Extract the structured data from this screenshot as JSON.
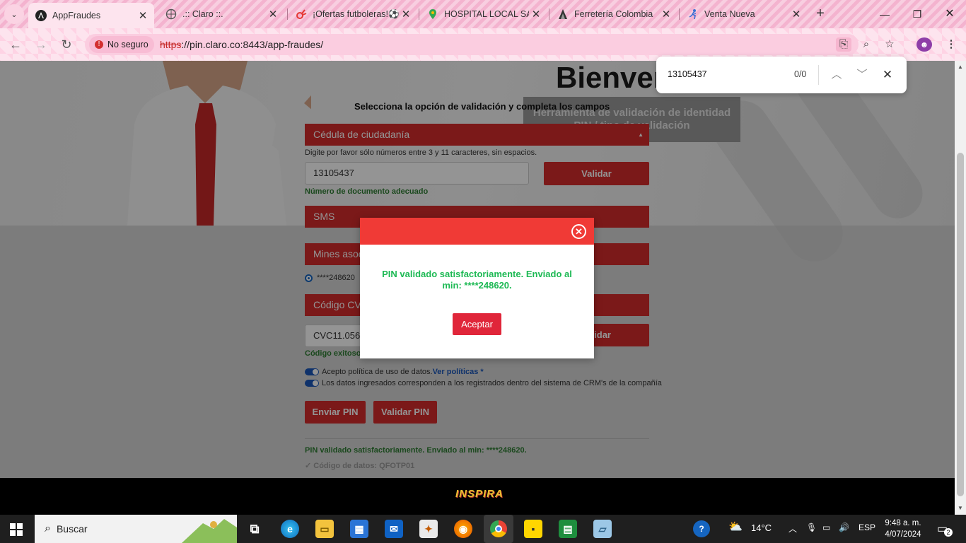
{
  "browser": {
    "tabs": [
      {
        "title": "AppFraudes",
        "active": true
      },
      {
        "title": ".:: Claro ::."
      },
      {
        "title": "¡Ofertas futboleras!⚽"
      },
      {
        "title": "HOSPITAL LOCAL SAC"
      },
      {
        "title": "Ferretería Colombia"
      },
      {
        "title": "Venta Nueva"
      }
    ],
    "security_chip": "No seguro",
    "url_scheme": "https",
    "url_rest": "://pin.claro.co:8443/app-fraudes/"
  },
  "find_bar": {
    "query": "13105437",
    "count": "0/0"
  },
  "page": {
    "title_partial": "Bienver",
    "tool_banner": "Herramienta de validación de identidad PIN / tipo de validación",
    "instruction": "Selecciona la opción de validación y completa los campos",
    "doc_type": "Cédula de ciudadanía",
    "doc_hint": "Digite por favor sólo números entre 3 y 11 caracteres, sin espacios.",
    "doc_value": "13105437",
    "validate_label": "Validar",
    "doc_ok": "Número de documento adecuado",
    "channel": "SMS",
    "mines_label": "Mines asoc",
    "msisdn_option": "****248620",
    "code_label": "Código CVC",
    "code_value": "CVC11.056",
    "validate_label_2": "lidar",
    "code_ok": "Código exitoso.",
    "accept_policy": "Acepto política de uso de datos.",
    "policy_link": "Ver políticas *",
    "crm_confirm": "Los datos ingresados corresponden a los registrados dentro del sistema de CRM's de la compañía",
    "send_pin": "Enviar PIN",
    "validate_pin": "Validar PIN",
    "result_msg": "PIN validado satisfactoriamente. Enviado al min: ****248620.",
    "data_code": "✓ Código de datos: QFOTP01",
    "footer_logo": "INSPIRA"
  },
  "modal": {
    "message": "PIN validado satisfactoriamente. Enviado al min: ****248620.",
    "accept": "Aceptar",
    "header_color": "#f03a36",
    "message_color": "#1db954"
  },
  "taskbar": {
    "search": "Buscar",
    "weather": "14°C",
    "lang": "ESP",
    "time": "9:48 a. m.",
    "date": "4/07/2024",
    "notifications": "2"
  },
  "colors": {
    "brand_red": "#d52b2b",
    "chrome_pink": "#f4b3cf"
  }
}
